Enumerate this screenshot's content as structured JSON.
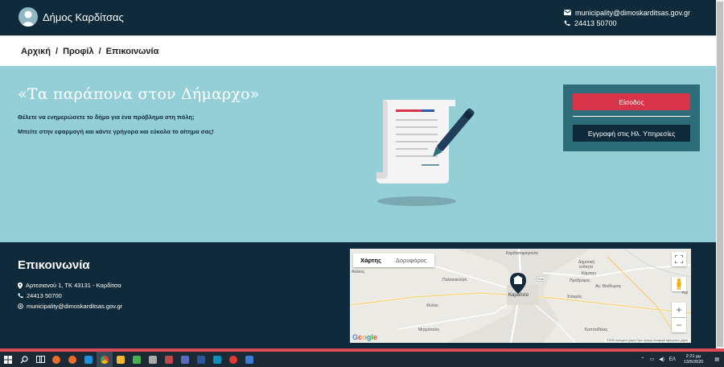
{
  "header": {
    "title": "Δήμος Καρδίτσας",
    "email": "municipality@dimoskarditsas.gov.gr",
    "phone": "24413 50700"
  },
  "breadcrumb": [
    "Αρχική",
    "Προφίλ",
    "Επικοινωνία"
  ],
  "hero": {
    "title": "«Τα παράπονα στον Δήμαρχο»",
    "line1": "Θέλετε να ενημερώσετε το δήμο για ένα πρόβλημα στη πόλη;",
    "line2": "Μπείτε στην εφαρμογή και κάντε γρήγορα και εύκολα το αίτημα σας!",
    "login_label": "Είσοδος",
    "register_label": "Εγγραφή στις Ηλ. Υπηρεσίες"
  },
  "footer": {
    "title": "Επικοινωνία",
    "address": "Αρτεσιανού 1, ΤΚ 43131 - Καρδίτσα",
    "phone": "24413 50700",
    "email": "municipality@dimoskarditsas.gov.gr"
  },
  "map": {
    "tab_map": "Χάρτης",
    "tab_satellite": "Δορυφόρος",
    "labels": {
      "karditsomagoula": "Καρδιτσομαγούλα",
      "akakos": "Ακάκος",
      "paleokklisi": "Παλαιοκκλήσι",
      "dimotiki": "Δημοτική",
      "enotita": "ενότητα",
      "kampou": "Κάμπου",
      "prodromos": "Πρόδρομος",
      "agios_theodoros": "Αγ. Θεόδωρος",
      "stavros": "Σταυρός",
      "fyllo": "Φύλλο",
      "karditsa": "Καρδίτσα",
      "mitropoli": "Μητρόπολη",
      "kappadokes": "Καππαδόκες",
      "kir": "Κιρ",
      "road": "E65"
    },
    "attribution": "©2020 Δεδομένα χάρτη   Όροι Χρήσης   Αναφορά σφάλματος χάρτη",
    "google": "Google"
  },
  "taskbar": {
    "lang": "ΕΛ",
    "time": "2:21 μμ",
    "date": "13/5/2020",
    "app_colors": [
      "#e8702a",
      "#e8702a",
      "#1e8fe1",
      "#aaaaaa",
      "#4caf50",
      "#f2b632",
      "#3a7bd5",
      "#c04848",
      "#2b579a",
      "#0a8fbf",
      "#e53935",
      "#5c6bc0"
    ]
  }
}
